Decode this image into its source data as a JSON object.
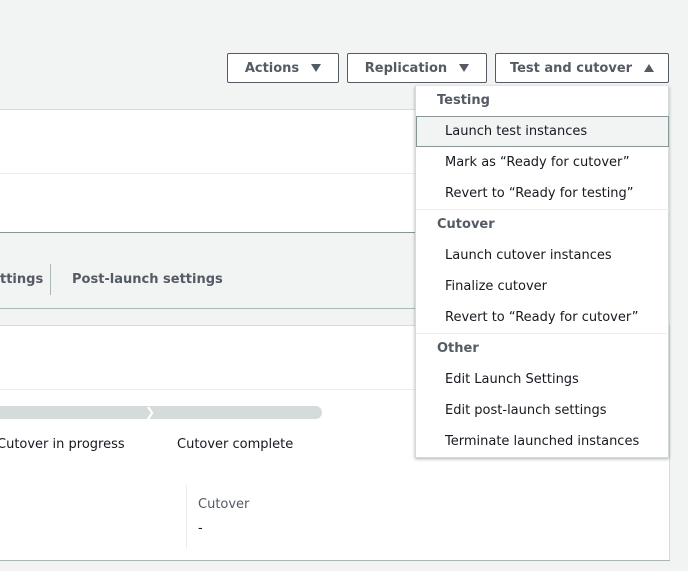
{
  "toolbar": {
    "actions_label": "Actions",
    "replication_label": "Replication",
    "test_cutover_label": "Test and cutover"
  },
  "tabs": {
    "settings_partial": "ttings",
    "post_launch": "Post-launch settings"
  },
  "lifecycle": {
    "progress_step_left": "Cutover in progress",
    "progress_step_right": "Cutover complete",
    "cutover_key": "Cutover",
    "cutover_value": "-"
  },
  "menu": {
    "groups": [
      {
        "header": "Testing",
        "items": [
          "Launch test instances",
          "Mark as “Ready for cutover”",
          "Revert to “Ready for testing”"
        ]
      },
      {
        "header": "Cutover",
        "items": [
          "Launch cutover instances",
          "Finalize cutover",
          "Revert to “Ready for cutover”"
        ]
      },
      {
        "header": "Other",
        "items": [
          "Edit Launch Settings",
          "Edit post-launch settings",
          "Terminate launched instances"
        ]
      }
    ]
  },
  "colors": {
    "page_bg": "#f2f3f3",
    "button_border": "#545b64",
    "menu_hover_bg": "#f2f3f3"
  }
}
